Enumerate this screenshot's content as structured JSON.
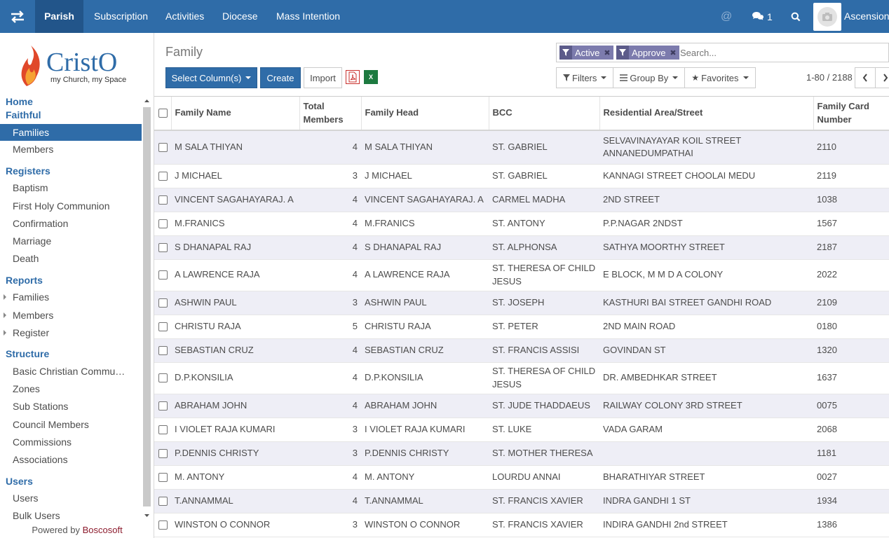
{
  "navbar": {
    "menus": [
      "Parish",
      "Subscription",
      "Activities",
      "Diocese",
      "Mass Intention"
    ],
    "active": "Parish",
    "chat_count": "1",
    "user_name": "Ascension"
  },
  "sidebar": {
    "logo_text": "CristO",
    "logo_tagline": "my Church, my Space",
    "home": "Home",
    "faithful": {
      "title": "Faithful",
      "items": [
        "Families",
        "Members"
      ]
    },
    "registers": {
      "title": "Registers",
      "items": [
        "Baptism",
        "First Holy Communion",
        "Confirmation",
        "Marriage",
        "Death"
      ]
    },
    "reports": {
      "title": "Reports",
      "items": [
        "Families",
        "Members",
        "Register"
      ]
    },
    "structure": {
      "title": "Structure",
      "items": [
        "Basic Christian Commu…",
        "Zones",
        "Sub Stations",
        "Council Members",
        "Commissions",
        "Associations"
      ]
    },
    "users": {
      "title": "Users",
      "items": [
        "Users",
        "Bulk Users"
      ]
    },
    "powered_prefix": "Powered by",
    "powered_brand": "Boscosoft"
  },
  "control": {
    "title": "Family",
    "select_columns": "Select Column(s)",
    "create": "Create",
    "import": "Import",
    "pdf_label": "PDF",
    "xls_label": "X",
    "facets": [
      "Active",
      "Approve"
    ],
    "search_placeholder": "Search...",
    "filters": "Filters",
    "group_by": "Group By",
    "favorites": "Favorites",
    "pager": "1-80 / 2188"
  },
  "table": {
    "headers": [
      "Family Name",
      "Total Members",
      "Family Head",
      "BCC",
      "Residential Area/Street",
      "Family Card Number"
    ],
    "rows": [
      [
        "M SALA THIYAN",
        "4",
        "M SALA THIYAN",
        "ST. GABRIEL",
        "SELVAVINAYAYAR KOIL STREET ANNANEDUMPATHAI",
        "2110"
      ],
      [
        "J MICHAEL",
        "3",
        "J MICHAEL",
        "ST. GABRIEL",
        "KANNAGI STREET CHOOLAI MEDU",
        "2119"
      ],
      [
        "VINCENT SAGAHAYARAJ. A",
        "4",
        "VINCENT SAGAHAYARAJ. A",
        "CARMEL MADHA",
        "2ND STREET",
        "1038"
      ],
      [
        "M.FRANICS",
        "4",
        "M.FRANICS",
        "ST. ANTONY",
        "P.P.NAGAR 2NDST",
        "1567"
      ],
      [
        "S DHANAPAL RAJ",
        "4",
        "S DHANAPAL RAJ",
        "ST. ALPHONSA",
        "SATHYA MOORTHY STREET",
        "2187"
      ],
      [
        "A LAWRENCE RAJA",
        "4",
        "A LAWRENCE RAJA",
        "ST. THERESA OF CHILD JESUS",
        "E BLOCK, M M D A COLONY",
        "2022"
      ],
      [
        "ASHWIN PAUL",
        "3",
        "ASHWIN PAUL",
        "ST. JOSEPH",
        "KASTHURI BAI STREET GANDHI ROAD",
        "2109"
      ],
      [
        "CHRISTU RAJA",
        "5",
        "CHRISTU RAJA",
        "ST. PETER",
        "2ND MAIN ROAD",
        "0180"
      ],
      [
        "SEBASTIAN CRUZ",
        "4",
        "SEBASTIAN CRUZ",
        "ST. FRANCIS ASSISI",
        "GOVINDAN ST",
        "1320"
      ],
      [
        "D.P.KONSILIA",
        "4",
        "D.P.KONSILIA",
        "ST. THERESA OF CHILD JESUS",
        "DR. AMBEDHKAR STREET",
        "1637"
      ],
      [
        "ABRAHAM JOHN",
        "4",
        "ABRAHAM JOHN",
        "ST. JUDE THADDAEUS",
        "RAILWAY COLONY 3RD STREET",
        "0075"
      ],
      [
        "I VIOLET RAJA KUMARI",
        "3",
        "I VIOLET RAJA KUMARI",
        "ST. LUKE",
        "VADA GARAM",
        "2068"
      ],
      [
        "P.DENNIS CHRISTY",
        "3",
        "P.DENNIS CHRISTY",
        "ST. MOTHER THERESA",
        "",
        "1181"
      ],
      [
        "M. ANTONY",
        "4",
        "M. ANTONY",
        "LOURDU ANNAI",
        "BHARATHIYAR STREET",
        "0027"
      ],
      [
        "T.ANNAMMAL",
        "4",
        "T.ANNAMMAL",
        "ST. FRANCIS XAVIER",
        "INDRA GANDHI 1 ST",
        "1934"
      ],
      [
        "WINSTON O CONNOR",
        "3",
        "WINSTON O CONNOR",
        "ST. FRANCIS XAVIER",
        "INDIRA GANDHI 2nd STREET",
        "1386"
      ]
    ]
  },
  "colors": {
    "brand": "#2f6ca8",
    "facet": "#7c7bad",
    "row_alt": "#eeeef6",
    "powered_brand": "#8c1b2d"
  }
}
